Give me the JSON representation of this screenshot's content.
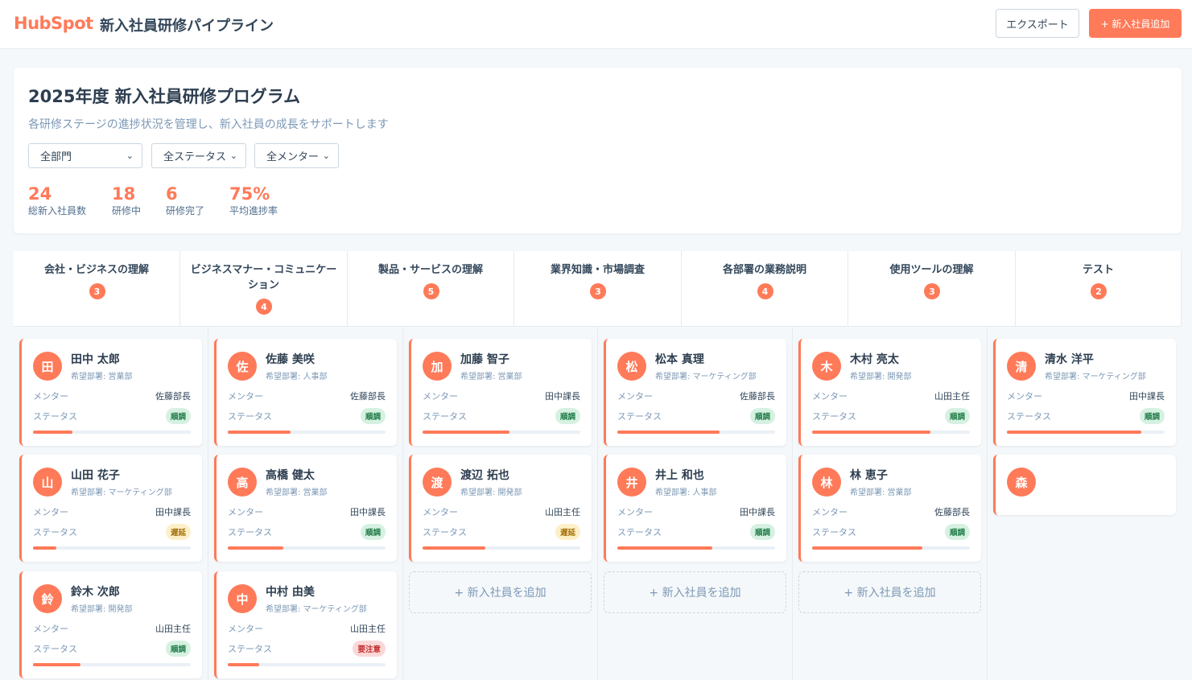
{
  "header": {
    "logo": "HubSpot",
    "title": "新入社員研修パイプライン",
    "export_label": "エクスポート",
    "add_label": "+ 新入社員追加"
  },
  "program": {
    "title": "2025年度 新入社員研修プログラム",
    "subtitle": "各研修ステージの進捗状況を管理し、新入社員の成長をサポートします",
    "filters": {
      "department": "全部門",
      "status": "全ステータス",
      "mentor": "全メンター"
    },
    "stats": [
      {
        "value": "24",
        "label": "総新入社員数"
      },
      {
        "value": "18",
        "label": "研修中"
      },
      {
        "value": "6",
        "label": "研修完了"
      },
      {
        "value": "75%",
        "label": "平均進捗率"
      }
    ]
  },
  "stages": [
    {
      "name": "会社・ビジネスの理解",
      "count": "3"
    },
    {
      "name": "ビジネスマナー・コミュニケーション",
      "count": "4"
    },
    {
      "name": "製品・サービスの理解",
      "count": "5"
    },
    {
      "name": "業界知識・市場調査",
      "count": "3"
    },
    {
      "name": "各部署の業務説明",
      "count": "4"
    },
    {
      "name": "使用ツールの理解",
      "count": "3"
    },
    {
      "name": "テスト",
      "count": "2"
    }
  ],
  "labels": {
    "mentor": "メンター",
    "status": "ステータス",
    "add_employee": "+ 新入社員を追加"
  },
  "columns": [
    {
      "cards": [
        {
          "initial": "田",
          "name": "田中 太郎",
          "dept": "希望部署: 営業部",
          "mentor": "佐藤部長",
          "status": "順調",
          "status_type": "ok",
          "progress": 0.25
        },
        {
          "initial": "山",
          "name": "山田 花子",
          "dept": "希望部署: マーケティング部",
          "mentor": "田中課長",
          "status": "遅延",
          "status_type": "late",
          "progress": 0.15
        },
        {
          "initial": "鈴",
          "name": "鈴木 次郎",
          "dept": "希望部署: 開発部",
          "mentor": "山田主任",
          "status": "順調",
          "status_type": "ok",
          "progress": 0.3
        }
      ]
    },
    {
      "cards": [
        {
          "initial": "佐",
          "name": "佐藤 美咲",
          "dept": "希望部署: 人事部",
          "mentor": "佐藤部長",
          "status": "順調",
          "status_type": "ok",
          "progress": 0.4
        },
        {
          "initial": "高",
          "name": "高橋 健太",
          "dept": "希望部署: 営業部",
          "mentor": "田中課長",
          "status": "順調",
          "status_type": "ok",
          "progress": 0.35
        },
        {
          "initial": "中",
          "name": "中村 由美",
          "dept": "希望部署: マーケティング部",
          "mentor": "山田主任",
          "status": "要注意",
          "status_type": "warn",
          "progress": 0.2
        }
      ]
    },
    {
      "cards": [
        {
          "initial": "加",
          "name": "加藤 智子",
          "dept": "希望部署: 営業部",
          "mentor": "田中課長",
          "status": "順調",
          "status_type": "ok",
          "progress": 0.55
        },
        {
          "initial": "渡",
          "name": "渡辺 拓也",
          "dept": "希望部署: 開発部",
          "mentor": "山田主任",
          "status": "遅延",
          "status_type": "late",
          "progress": 0.4
        }
      ],
      "add": true
    },
    {
      "cards": [
        {
          "initial": "松",
          "name": "松本 真理",
          "dept": "希望部署: マーケティング部",
          "mentor": "佐藤部長",
          "status": "順調",
          "status_type": "ok",
          "progress": 0.65
        },
        {
          "initial": "井",
          "name": "井上 和也",
          "dept": "希望部署: 人事部",
          "mentor": "田中課長",
          "status": "順調",
          "status_type": "ok",
          "progress": 0.6
        }
      ],
      "add": true
    },
    {
      "cards": [
        {
          "initial": "木",
          "name": "木村 亮太",
          "dept": "希望部署: 開発部",
          "mentor": "山田主任",
          "status": "順調",
          "status_type": "ok",
          "progress": 0.75
        },
        {
          "initial": "林",
          "name": "林 恵子",
          "dept": "希望部署: 営業部",
          "mentor": "佐藤部長",
          "status": "順調",
          "status_type": "ok",
          "progress": 0.7
        }
      ],
      "add": true
    },
    {
      "cards": [
        {
          "initial": "清",
          "name": "清水 洋平",
          "dept": "希望部署: マーケティング部",
          "mentor": "田中課長",
          "status": "順調",
          "status_type": "ok",
          "progress": 0.85
        },
        {
          "initial": "森",
          "partial": true
        }
      ]
    }
  ],
  "colors": {
    "accent": "#ff7a59",
    "text": "#33475b",
    "muted": "#7c98b6",
    "ok": "#d6f1e1",
    "late": "#fdf0c8",
    "warn": "#fbd8d8"
  }
}
